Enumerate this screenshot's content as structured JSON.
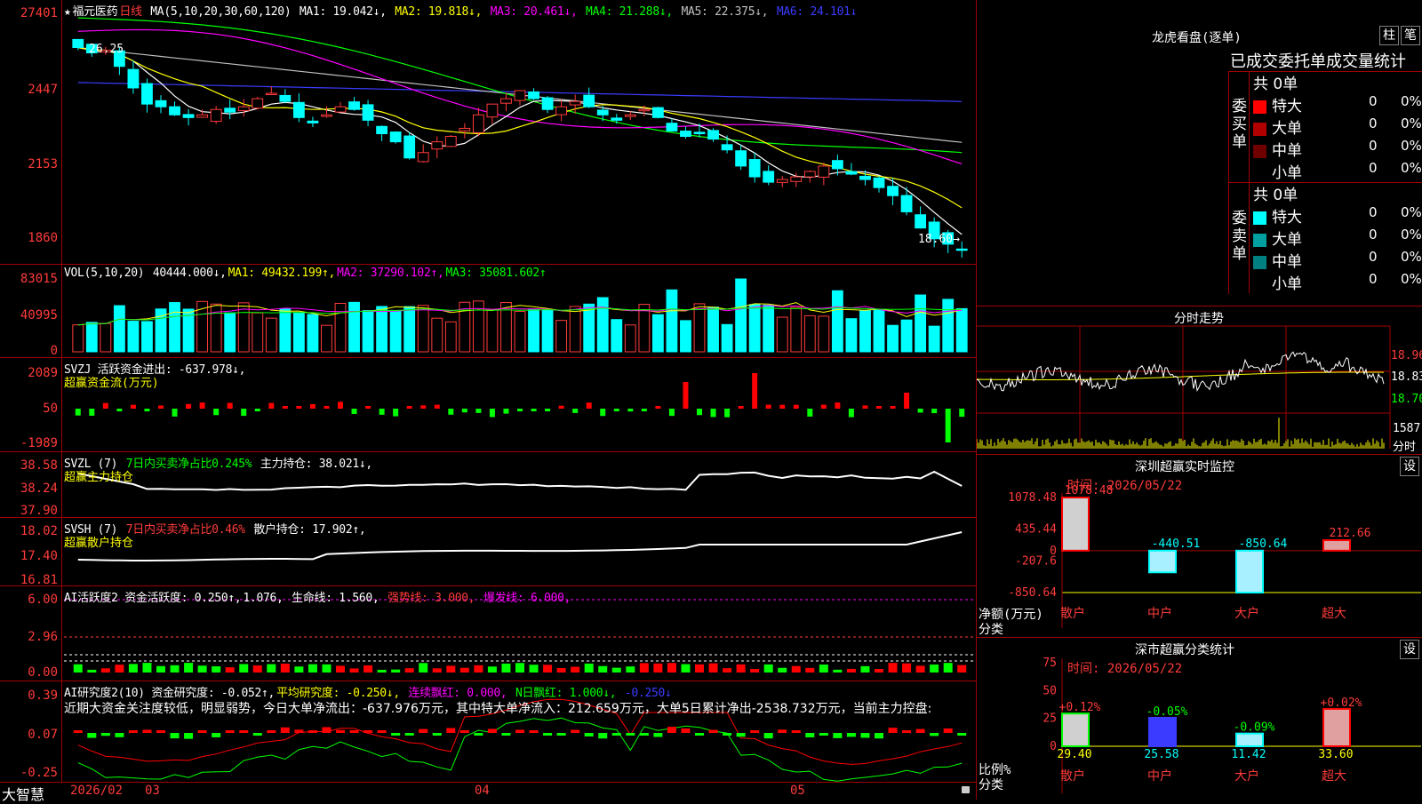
{
  "stock": {
    "name": "福元医药",
    "period": "日线",
    "star": "★"
  },
  "price_pane": {
    "ma_label": "MA(5,10,20,30,60,120)",
    "ma": [
      {
        "label": "MA1: 19.042↓,",
        "color": "#ffffff"
      },
      {
        "label": "MA2: 19.818↓,",
        "color": "#ffff00"
      },
      {
        "label": "MA3: 20.461↓,",
        "color": "#ff00ff"
      },
      {
        "label": "MA4: 21.288↓,",
        "color": "#00ff00"
      },
      {
        "label": "MA5: 22.375↓,",
        "color": "#c0c0c0"
      },
      {
        "label": "MA6: 24.101↓",
        "color": "#3b3bff"
      }
    ],
    "yticks": [
      "27401",
      "2447",
      "2153",
      "1860"
    ],
    "high_label": "26.25",
    "low_label": "18.60→"
  },
  "vol_pane": {
    "label": "VOL(5,10,20)",
    "value": "40444.000↓,",
    "ma1": "MA1: 49432.199↑,",
    "ma2": "MA2: 37290.102↑,",
    "ma3": "MA3: 35081.602↑",
    "yticks": [
      "83015",
      "40995",
      "0"
    ]
  },
  "svzj_pane": {
    "label": "SVZJ  活跃资金进出: -637.978↓,",
    "sub": "超赢资金流(万元)",
    "yticks": [
      "2089",
      "50",
      "-1989"
    ]
  },
  "svzl_pane": {
    "label": "SVZL (7)",
    "ratio": "7日内买卖净占比0.245%",
    "hold": "主力持仓: 38.021↓,",
    "sub": "超赢主力持仓",
    "yticks": [
      "38.58",
      "38.24",
      "37.90"
    ]
  },
  "svsh_pane": {
    "label": "SVSH (7)",
    "ratio": "7日内买卖净占比0.46%",
    "hold": "散户持仓: 17.902↑,",
    "sub": "超赢散户持仓",
    "yticks": [
      "18.02",
      "17.40",
      "16.81"
    ]
  },
  "ai_active_pane": {
    "label": "AI活跃度2 资金活跃度: 0.250↑,",
    "v2": "1.076,",
    "life": "生命线: 1.560,",
    "strong": "强势线: 3.000,",
    "burst": "爆发线: 6.000,",
    "yticks": [
      "6.00",
      "2.96",
      "0.00"
    ]
  },
  "ai_research_pane": {
    "label": "AI研究度2(10) 资金研究度: -0.052↑,",
    "avg": "平均研究度: -0.250↓,",
    "cont": "连续飘红: 0.000,",
    "nday": "N日飘红: 1.000↓,",
    "last": "-0.250↓",
    "commentary": "近期大资金关注度较低，明显弱势，今日大单净流出：-637.976万元，其中特大单净流入：212.659万元，大单5日累计净出-2538.732万元，当前主力控盘:",
    "yticks": [
      "0.39",
      "0.07",
      "-0.25"
    ]
  },
  "time_axis": {
    "logo": "大智慧",
    "labels": [
      "2026/02",
      "03",
      "04",
      "05"
    ]
  },
  "dragon_tiger": {
    "title": "龙虎看盘(逐单)",
    "btn1": "柱",
    "btn2": "笔",
    "head": "已成交委托单成交量统计",
    "buy_label": "委买单",
    "sell_label": "委卖单",
    "buy_total": "共 0单",
    "sell_total": "共 0单",
    "buy_rows": [
      {
        "name": "特大",
        "count": "0",
        "pct": "0%",
        "color": "#ff0000"
      },
      {
        "name": "大单",
        "count": "0",
        "pct": "0%",
        "color": "#b00000"
      },
      {
        "name": "中单",
        "count": "0",
        "pct": "0%",
        "color": "#700000"
      },
      {
        "name": "小单",
        "count": "0",
        "pct": "0%",
        "color": ""
      }
    ],
    "sell_rows": [
      {
        "name": "特大",
        "count": "0",
        "pct": "0%",
        "color": "#00ffff"
      },
      {
        "name": "大单",
        "count": "0",
        "pct": "0%",
        "color": "#00a0a0"
      },
      {
        "name": "中单",
        "count": "0",
        "pct": "0%",
        "color": "#008080"
      },
      {
        "name": "小单",
        "count": "0",
        "pct": "0%",
        "color": ""
      }
    ]
  },
  "intraday": {
    "title": "分时走势",
    "yticks": [
      "18.96",
      "18.83",
      "18.70"
    ],
    "vol_tick": "1587",
    "vol_label": "分时"
  },
  "monitor": {
    "title": "深圳超赢实时监控",
    "btn": "设",
    "time": "时间: 2026/05/22",
    "yticks": [
      "1078.48",
      "435.44",
      "0",
      "-207.6",
      "-850.64"
    ],
    "side_label1": "净额(万元)",
    "side_label2": "分类"
  },
  "classify": {
    "title": "深市超赢分类统计",
    "btn": "设",
    "time": "时间: 2026/05/22",
    "yticks": [
      "75",
      "50",
      "25",
      "0"
    ],
    "side_label1": "比例%",
    "side_label2": "分类"
  },
  "chart_data": [
    {
      "type": "bar",
      "title": "深圳超赢实时监控",
      "categories": [
        "散户",
        "中户",
        "大户",
        "超大"
      ],
      "values": [
        1078.48,
        -440.51,
        -850.64,
        212.66
      ],
      "value_labels": [
        "1078.48",
        "-440.51",
        "-850.64",
        "212.66"
      ],
      "ylabel": "净额(万元)",
      "ylim": [
        -850.64,
        1078.48
      ]
    },
    {
      "type": "bar",
      "title": "深市超赢分类统计",
      "categories": [
        "散户",
        "中户",
        "大户",
        "超大"
      ],
      "values": [
        29.4,
        25.58,
        11.42,
        33.6
      ],
      "value_labels": [
        "29.40",
        "25.58",
        "11.42",
        "33.60"
      ],
      "changes": [
        "+0.12%",
        "-0.05%",
        "-0.09%",
        "+0.02%"
      ],
      "ylabel": "比例%",
      "ylim": [
        0,
        75
      ]
    },
    {
      "type": "line",
      "title": "日线 K线",
      "x_ticks": [
        "2026/02",
        "03",
        "04",
        "05"
      ],
      "series": [
        {
          "name": "MA1",
          "last": 19.042
        },
        {
          "name": "MA2",
          "last": 19.818
        },
        {
          "name": "MA3",
          "last": 20.461
        },
        {
          "name": "MA4",
          "last": 21.288
        },
        {
          "name": "MA5",
          "last": 22.375
        },
        {
          "name": "MA6",
          "last": 24.101
        }
      ],
      "close": [
        26.1,
        25.9,
        26.0,
        25.4,
        24.6,
        24.0,
        23.9,
        23.6,
        23.5,
        23.6,
        23.8,
        23.7,
        23.9,
        24.2,
        24.4,
        24.1,
        23.5,
        23.3,
        23.6,
        23.9,
        23.8,
        23.4,
        22.9,
        22.6,
        22.0,
        22.2,
        22.6,
        22.8,
        23.1,
        23.6,
        24.0,
        24.2,
        24.5,
        24.2,
        23.8,
        23.9,
        24.1,
        23.9,
        23.6,
        23.4,
        23.6,
        23.8,
        23.5,
        23.0,
        22.8,
        22.9,
        22.7,
        22.3,
        21.7,
        21.3,
        21.1,
        21.2,
        21.3,
        21.5,
        21.7,
        21.6,
        21.4,
        21.2,
        20.9,
        20.6,
        20.0,
        19.4,
        19.0,
        18.8,
        18.6
      ],
      "ylim": [
        18.6,
        27.4
      ]
    }
  ],
  "colors": {
    "up": "#ff3b3b",
    "down": "#00ffff",
    "grid": "#a00000",
    "axis_text": "#ff3b3b"
  }
}
